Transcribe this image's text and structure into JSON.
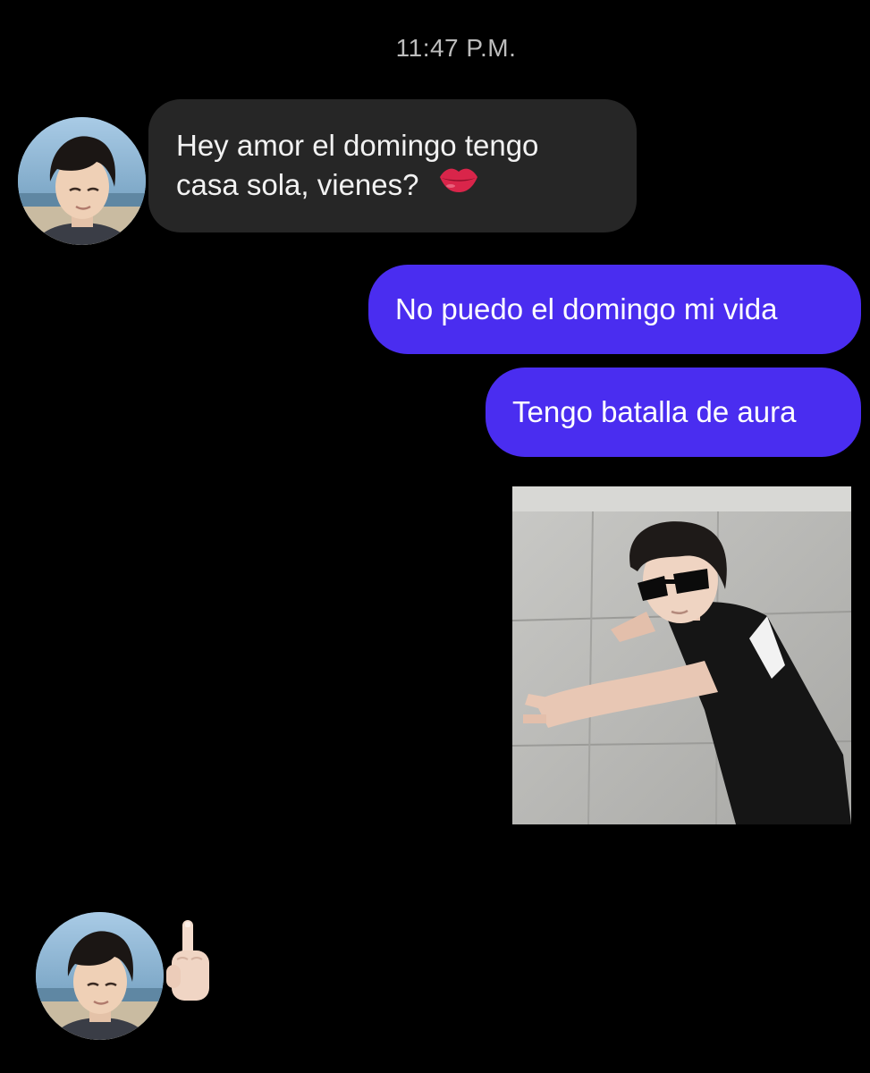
{
  "header": {
    "timestamp": "11:47 P.M."
  },
  "messages": [
    {
      "direction": "incoming",
      "lines": [
        "Hey amor el domingo tengo",
        "casa sola, vienes?"
      ],
      "emoji": "lips-icon"
    },
    {
      "direction": "outgoing",
      "text": "No puedo el domingo mi vida"
    },
    {
      "direction": "outgoing",
      "text": "Tengo batalla de aura"
    },
    {
      "direction": "outgoing",
      "type": "image",
      "image": "photo-person-sunglasses-pointing"
    },
    {
      "direction": "incoming",
      "type": "emoji",
      "emoji": "middle-finger-icon"
    }
  ],
  "colors": {
    "background": "#000000",
    "incoming_bubble": "#262626",
    "outgoing_bubble": "#4a2df0",
    "timestamp_text": "#bdbdbd"
  }
}
